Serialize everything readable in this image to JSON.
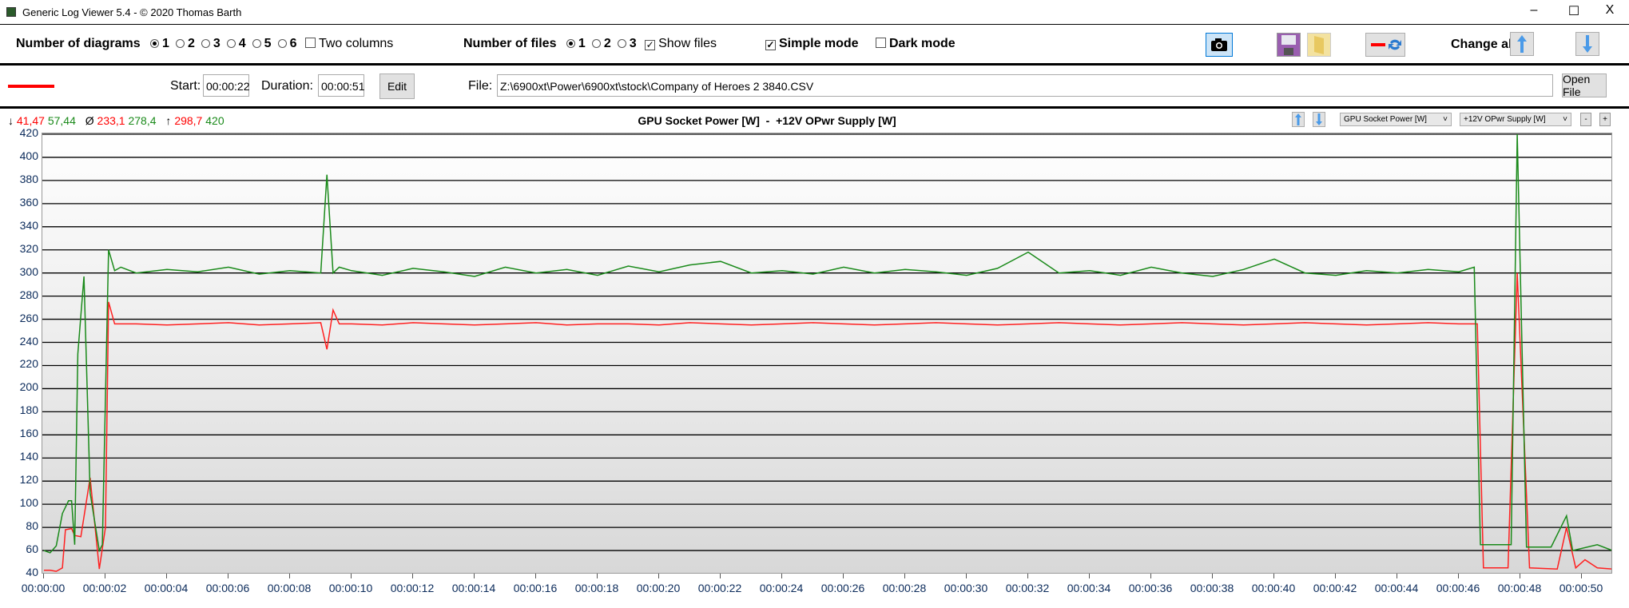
{
  "window": {
    "title": "Generic Log Viewer 5.4 - © 2020 Thomas Barth",
    "minimize": "–",
    "maximize": "☐",
    "close": "X"
  },
  "toolbar": {
    "num_diagrams_label": "Number of diagrams",
    "diagram_options": [
      "1",
      "2",
      "3",
      "4",
      "5",
      "6"
    ],
    "diagram_selected": "1",
    "two_columns": "Two columns",
    "num_files_label": "Number of files",
    "file_options": [
      "1",
      "2",
      "3"
    ],
    "files_selected": "1",
    "show_files": "Show files",
    "simple_mode": "Simple mode",
    "dark_mode": "Dark mode",
    "change_all": "Change all"
  },
  "file_row": {
    "start_label": "Start:",
    "start_value": "00:00:22",
    "duration_label": "Duration:",
    "duration_value": "00:00:51",
    "edit": "Edit",
    "file_label": "File:",
    "file_path": "Z:\\6900xt\\Power\\6900xt\\stock\\Company of Heroes 2 3840.CSV",
    "open_file": "Open File",
    "line_color": "#ff0000"
  },
  "stats": {
    "min_arrow": "↓",
    "min_red": "41,47",
    "min_green": "57,44",
    "avg_symbol": "Ø",
    "avg_red": "233,1",
    "avg_green": "278,4",
    "max_arrow": "↑",
    "max_red": "298,7",
    "max_green": "420"
  },
  "diagram_header": {
    "title": "GPU Socket Power [W]  -  +12V OPwr Supply [W]",
    "select1": "GPU Socket Power [W]",
    "select2": "+12V OPwr Supply [W]",
    "minus": "-",
    "plus": "+"
  },
  "chart_data": {
    "type": "line",
    "title": "GPU Socket Power [W]  -  +12V OPwr Supply [W]",
    "ylim": [
      40,
      420
    ],
    "xlim": [
      0,
      51
    ],
    "yticks": [
      "40",
      "60",
      "80",
      "100",
      "120",
      "140",
      "160",
      "180",
      "200",
      "220",
      "240",
      "260",
      "280",
      "300",
      "320",
      "340",
      "360",
      "380",
      "400",
      "420"
    ],
    "xticks": [
      "00:00:00",
      "00:00:02",
      "00:00:04",
      "00:00:06",
      "00:00:08",
      "00:00:10",
      "00:00:12",
      "00:00:14",
      "00:00:16",
      "00:00:18",
      "00:00:20",
      "00:00:22",
      "00:00:24",
      "00:00:26",
      "00:00:28",
      "00:00:30",
      "00:00:32",
      "00:00:34",
      "00:00:36",
      "00:00:38",
      "00:00:40",
      "00:00:42",
      "00:00:44",
      "00:00:46",
      "00:00:48",
      "00:00:50"
    ],
    "series": [
      {
        "name": "GPU Socket Power [W]",
        "color": "#ff2020",
        "x": [
          0,
          0.2,
          0.4,
          0.6,
          0.7,
          0.9,
          1.0,
          1.2,
          1.5,
          1.8,
          2.0,
          2.1,
          2.3,
          3,
          4,
          5,
          6,
          7,
          8,
          9,
          9.2,
          9.4,
          9.6,
          10,
          11,
          12,
          13,
          14,
          15,
          16,
          17,
          18,
          19,
          20,
          21,
          22,
          23,
          24,
          25,
          26,
          27,
          28,
          29,
          30,
          31,
          32,
          33,
          34,
          35,
          36,
          37,
          38,
          39,
          40,
          41,
          42,
          43,
          44,
          45,
          46,
          46.6,
          46.8,
          47.6,
          47.9,
          48.3,
          49.2,
          49.5,
          49.8,
          50.1,
          50.5,
          51
        ],
        "values": [
          43,
          43,
          42,
          45,
          78,
          79,
          73,
          72,
          123,
          44,
          80,
          275,
          256,
          256,
          255,
          256,
          257,
          255,
          256,
          257,
          234,
          268,
          256,
          256,
          255,
          257,
          256,
          255,
          256,
          257,
          255,
          256,
          256,
          255,
          257,
          256,
          255,
          256,
          257,
          256,
          255,
          256,
          257,
          256,
          255,
          256,
          257,
          256,
          255,
          256,
          257,
          256,
          255,
          256,
          257,
          256,
          255,
          256,
          257,
          256,
          256,
          45,
          45,
          300,
          45,
          44,
          80,
          45,
          52,
          45,
          44
        ]
      },
      {
        "name": "+12V OPwr Supply [W]",
        "color": "#1a8a1a",
        "x": [
          0,
          0.2,
          0.4,
          0.6,
          0.8,
          0.9,
          1.0,
          1.1,
          1.3,
          1.5,
          1.8,
          1.9,
          2.1,
          2.3,
          2.5,
          3,
          4,
          5,
          6,
          7,
          8,
          9,
          9.2,
          9.4,
          9.6,
          10,
          11,
          12,
          13,
          14,
          15,
          16,
          17,
          18,
          19,
          20,
          21,
          22,
          23,
          24,
          25,
          26,
          27,
          28,
          29,
          30,
          31,
          32,
          33,
          34,
          35,
          36,
          37,
          38,
          39,
          40,
          41,
          42,
          43,
          44,
          45,
          46,
          46.5,
          46.7,
          47.7,
          47.9,
          48.2,
          49.0,
          49.5,
          49.7,
          50.5,
          51
        ],
        "values": [
          60,
          58,
          64,
          92,
          103,
          103,
          65,
          230,
          297,
          110,
          60,
          65,
          320,
          302,
          305,
          300,
          303,
          301,
          305,
          299,
          302,
          300,
          385,
          300,
          305,
          302,
          298,
          304,
          301,
          297,
          305,
          300,
          303,
          298,
          306,
          301,
          307,
          310,
          300,
          302,
          299,
          305,
          300,
          303,
          301,
          298,
          304,
          318,
          300,
          302,
          298,
          305,
          300,
          297,
          303,
          312,
          300,
          298,
          302,
          300,
          303,
          301,
          305,
          65,
          65,
          420,
          63,
          63,
          90,
          60,
          65,
          60
        ]
      }
    ]
  }
}
